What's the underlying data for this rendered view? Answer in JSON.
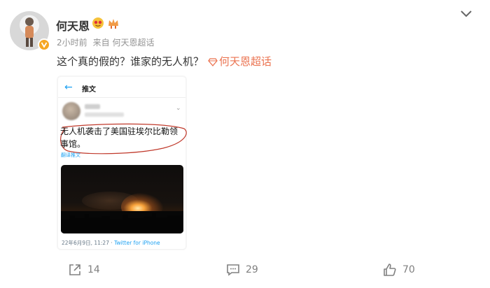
{
  "post": {
    "author": "何天恩",
    "time": "2小时前",
    "source_prefix": "来自",
    "source": "何天恩超话",
    "text": "这个真的假的？谁家的无人机？",
    "topic_link": "何天恩超话"
  },
  "card": {
    "back_glyph": "←",
    "title": "推文",
    "tweet_text": "无人机袭击了美国驻埃尔比勒领事馆。",
    "translate": "翻译推文",
    "date": "22年6月9日, 11:27 ·",
    "source": "Twitter for iPhone"
  },
  "actions": {
    "share_count": "14",
    "comment_count": "29",
    "like_count": "70"
  },
  "colors": {
    "link": "#eb7350",
    "twitter_blue": "#1da1f2",
    "badge_orange": "#f6a623",
    "circle_red": "#c0392b"
  },
  "icons": [
    "avatar",
    "verified-badge-icon",
    "emoji-badge-icon",
    "crown-badge-icon",
    "chevron-down-icon",
    "topic-diamond-icon",
    "share-icon",
    "comment-icon",
    "like-icon"
  ]
}
